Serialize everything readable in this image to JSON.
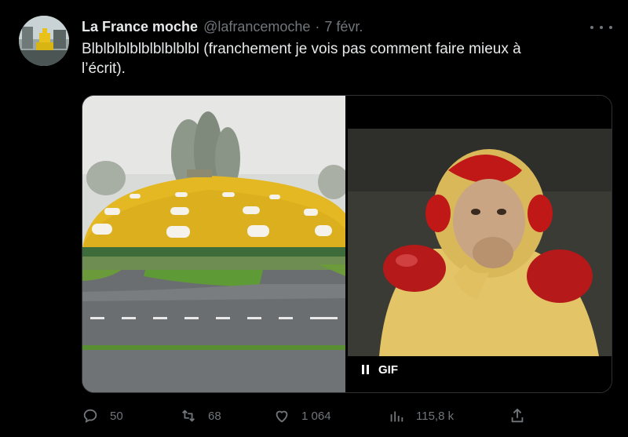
{
  "tweet": {
    "display_name": "La France moche",
    "handle": "@lafrancemoche",
    "separator": "·",
    "date": "7 févr.",
    "text": "Blblblblblblblblblbl (franchement je vois pas comment faire mieux à\nl’écrit).",
    "media": {
      "left_image": "yellow-dome-building-photo",
      "right_image": "gif-man-in-yellow-red-costume",
      "gif_label": "GIF"
    },
    "actions": {
      "replies": "50",
      "reposts": "68",
      "likes": "1 064",
      "views": "115,8 k"
    }
  },
  "colors": {
    "background": "#000000",
    "primary_text": "#e7e9ea",
    "secondary_text": "#71767b",
    "border": "#2f3336"
  }
}
